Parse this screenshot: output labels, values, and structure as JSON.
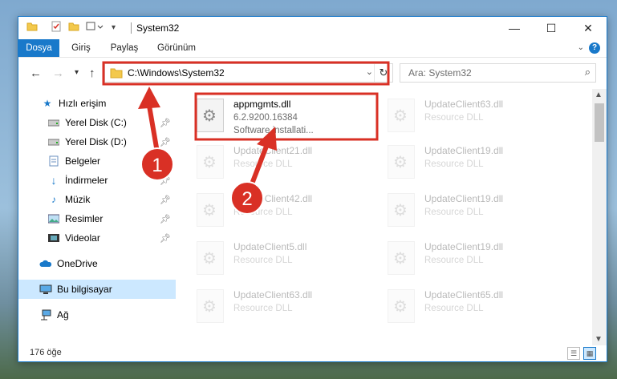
{
  "window": {
    "title": "System32",
    "controls": {
      "minimize": "—",
      "maximize": "☐",
      "close": "✕"
    }
  },
  "ribbon": {
    "tabs": [
      "Dosya",
      "Giriş",
      "Paylaş",
      "Görünüm"
    ],
    "help": "?"
  },
  "nav": {
    "address": "C:\\Windows\\System32",
    "search_placeholder": "Ara: System32"
  },
  "sidebar": {
    "items": [
      {
        "label": "Hızlı erişim",
        "icon": "star-icon"
      },
      {
        "label": "Yerel Disk (C:)",
        "icon": "drive-icon",
        "pinned": true
      },
      {
        "label": "Yerel Disk (D:)",
        "icon": "drive-icon",
        "pinned": true
      },
      {
        "label": "Belgeler",
        "icon": "documents-icon",
        "pinned": true
      },
      {
        "label": "İndirmeler",
        "icon": "download-icon",
        "pinned": true
      },
      {
        "label": "Müzik",
        "icon": "music-icon",
        "pinned": true
      },
      {
        "label": "Resimler",
        "icon": "pictures-icon",
        "pinned": true
      },
      {
        "label": "Videolar",
        "icon": "video-icon",
        "pinned": true
      },
      {
        "label": "OneDrive",
        "icon": "cloud-icon"
      },
      {
        "label": "Bu bilgisayar",
        "icon": "computer-icon",
        "selected": true
      },
      {
        "label": "Ağ",
        "icon": "network-icon"
      }
    ]
  },
  "files": {
    "highlighted": {
      "name": "appmgmts.dll",
      "version": "6.2.9200.16384",
      "description": "Software installati..."
    },
    "col1": [
      {
        "name": "UpdateClient21.dll",
        "type": "Resource DLL"
      },
      {
        "name": "UpdateClient42.dll",
        "type": "Resource DLL"
      },
      {
        "name": "UpdateClient5.dll",
        "type": "Resource DLL"
      },
      {
        "name": "UpdateClient63.dll",
        "type": "Resource DLL"
      }
    ],
    "col2": [
      {
        "name": "UpdateClient63.dll",
        "type": "Resource DLL"
      },
      {
        "name": "UpdateClient19.dll",
        "type": "Resource DLL"
      },
      {
        "name": "UpdateClient19.dll",
        "type": "Resource DLL"
      },
      {
        "name": "UpdateClient19.dll",
        "type": "Resource DLL"
      },
      {
        "name": "UpdateClient65.dll",
        "type": "Resource DLL"
      }
    ]
  },
  "status": {
    "count": "176 öğe"
  },
  "callouts": {
    "one": "1",
    "two": "2"
  },
  "colors": {
    "accent": "#1979ca",
    "callout": "#d93025",
    "selection": "#cce8ff"
  }
}
